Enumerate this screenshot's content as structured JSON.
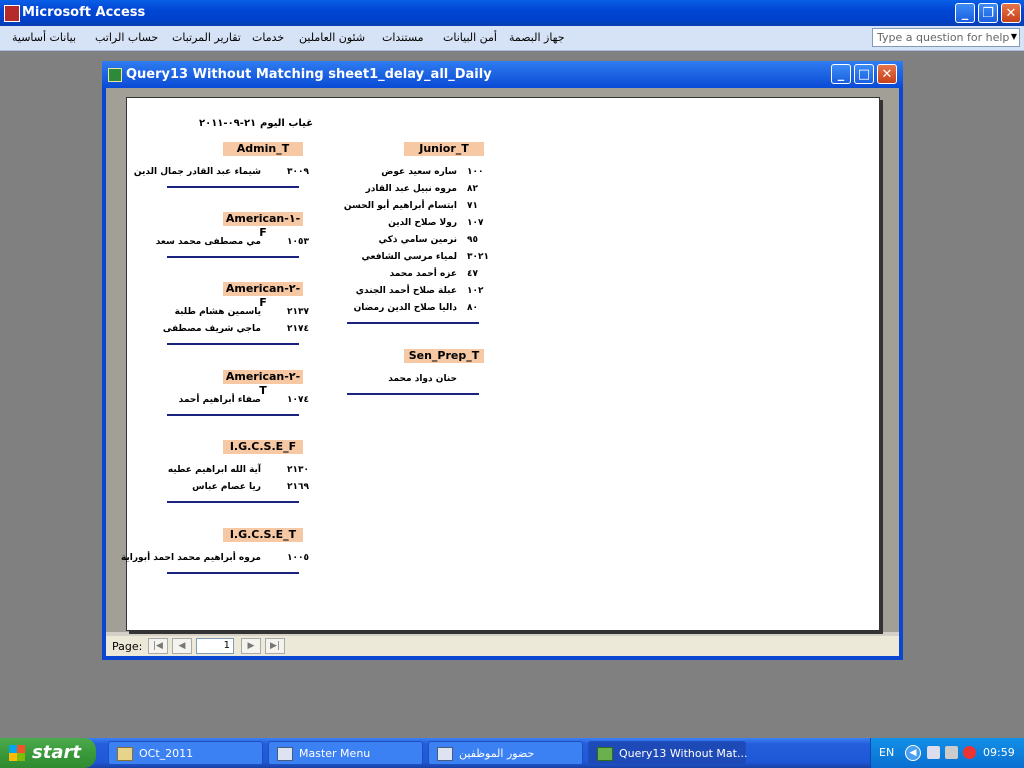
{
  "app": {
    "title": "Microsoft Access"
  },
  "menu": {
    "items": [
      "جهاز البصمة",
      "أمن البيانات",
      "مستندات",
      "شئون العاملين",
      "خدمات",
      "تقارير المرتبات",
      "حساب الراتب",
      "بيانات أساسية"
    ],
    "help_placeholder": "Type a question for help"
  },
  "child": {
    "title": "Query13 Without Matching sheet1_delay_all_Daily",
    "page_label": "Page:",
    "page_number": "1"
  },
  "report": {
    "title": "غياب اليوم",
    "date": "٢١-٠٩-٢٠١١",
    "left_groups": [
      {
        "header": "Admin_T",
        "rows": [
          {
            "id": "٣٠٠٩",
            "name": "شيماء عبد القادر جمال الدين"
          }
        ]
      },
      {
        "header": "American-١-F",
        "rows": [
          {
            "id": "١٠٥٣",
            "name": "مي مصطفى محمد سعد"
          }
        ]
      },
      {
        "header": "American-٢-F",
        "rows": [
          {
            "id": "٢١٣٧",
            "name": "ياسمين هشام طلبة"
          },
          {
            "id": "٢١٧٤",
            "name": "ماجي شريف مصطفى"
          }
        ]
      },
      {
        "header": "American-٢-T",
        "rows": [
          {
            "id": "١٠٧٤",
            "name": "صفاء أبراهيم أحمد"
          }
        ]
      },
      {
        "header": "I.G.C.S.E_F",
        "rows": [
          {
            "id": "٢١٣٠",
            "name": "آية الله ابراهيم عطيه"
          },
          {
            "id": "٢١٦٩",
            "name": "ريا عصام عباس"
          }
        ]
      },
      {
        "header": "I.G.C.S.E_T",
        "rows": [
          {
            "id": "١٠٠٥",
            "name": "مروه أبراهيم محمد احمد أبوراية"
          }
        ]
      }
    ],
    "right_groups": [
      {
        "header": "Junior_T",
        "rows": [
          {
            "id": "١٠٠",
            "name": "ساره سعيد عوض"
          },
          {
            "id": "٨٢",
            "name": "مروه نبيل عبد القادر"
          },
          {
            "id": "٧١",
            "name": "ابتسام أبراهيم أبو الحسن"
          },
          {
            "id": "١٠٧",
            "name": "رولا صلاح الدين"
          },
          {
            "id": "٩٥",
            "name": "نرمين سامي ذكي"
          },
          {
            "id": "٣٠٢١",
            "name": "لمياء مرسي الشافعي"
          },
          {
            "id": "٤٧",
            "name": "عزه أحمد محمد"
          },
          {
            "id": "١٠٢",
            "name": "عبلة صلاح أحمد الجندي"
          },
          {
            "id": "٨٠",
            "name": "داليا صلاح الدين رمضان"
          }
        ]
      },
      {
        "header": "Sen_Prep_T",
        "rows": [
          {
            "id": "",
            "name": "حنان دواد محمد"
          }
        ]
      }
    ]
  },
  "taskbar": {
    "start": "start",
    "items": [
      "OCt_2011",
      "Master Menu",
      "حضور الموظفين",
      "Query13 Without Mat..."
    ],
    "lang": "EN",
    "clock": "09:59"
  }
}
